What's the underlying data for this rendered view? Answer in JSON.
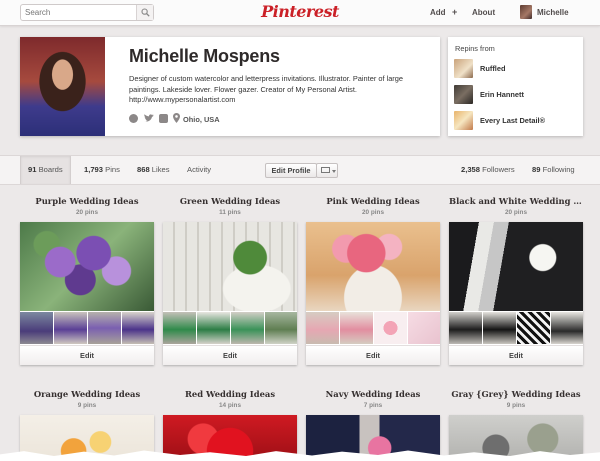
{
  "nav": {
    "search_placeholder": "Search",
    "logo": "Pinterest",
    "add_label": "Add",
    "add_plus": "+",
    "about_label": "About",
    "user_name": "Michelle"
  },
  "profile": {
    "name": "Michelle Mospens",
    "bio": "Designer of custom watercolor and letterpress invitations. Illustrator. Painter of large paintings. Lakeside lover. Flower gazer. Creator of My Personal Artist.",
    "url": "http://www.mypersonalartist.com",
    "location": "Ohio, USA"
  },
  "repins": {
    "title": "Repins from",
    "items": [
      {
        "name": "Ruffled"
      },
      {
        "name": "Erin Hannett"
      },
      {
        "name": "Every Last Detail®"
      }
    ]
  },
  "stats": {
    "boards_count": "91",
    "boards_label": "Boards",
    "pins_count": "1,793",
    "pins_label": "Pins",
    "likes_count": "868",
    "likes_label": "Likes",
    "activity_label": "Activity",
    "edit_profile_label": "Edit Profile",
    "followers_count": "2,358",
    "followers_label": "Followers",
    "following_count": "89",
    "following_label": "Following"
  },
  "boards": [
    {
      "title": "Purple Wedding Ideas",
      "count": "20 pins",
      "edit": "Edit"
    },
    {
      "title": "Green Wedding Ideas",
      "count": "11 pins",
      "edit": "Edit"
    },
    {
      "title": "Pink Wedding Ideas",
      "count": "20 pins",
      "edit": "Edit"
    },
    {
      "title": "Black and White Wedding Ideas",
      "count": "20 pins",
      "edit": "Edit"
    },
    {
      "title": "Orange Wedding Ideas",
      "count": "9 pins"
    },
    {
      "title": "Red Wedding Ideas",
      "count": "14 pins"
    },
    {
      "title": "Navy Wedding Ideas",
      "count": "7 pins"
    },
    {
      "title": "Gray {Grey} Wedding Ideas",
      "count": "9 pins"
    }
  ],
  "colors": {
    "brand_red": "#cb2027",
    "background": "#ece9e9"
  }
}
